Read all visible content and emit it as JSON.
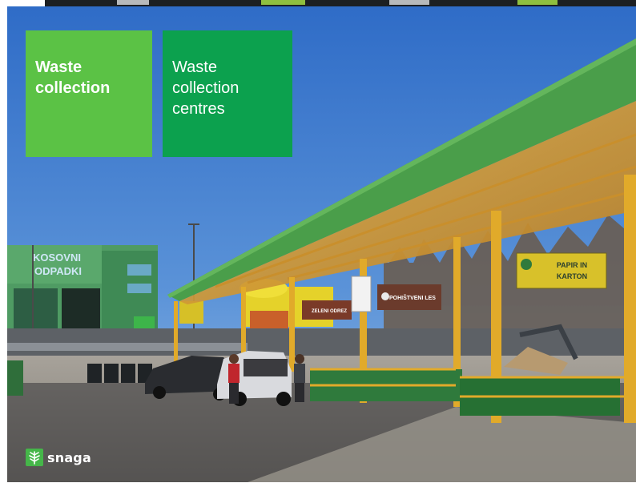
{
  "tiles": [
    {
      "line1": "Waste",
      "line2": "collection",
      "line3": ""
    },
    {
      "line1": "Waste",
      "line2": "collection",
      "line3": "centres"
    }
  ],
  "signs": {
    "building": {
      "line1": "KOSOVNI",
      "line2": "ODPADKI"
    },
    "papir": {
      "line1": "PAPIR IN",
      "line2": "KARTON"
    },
    "pohistveni": "POHIŠTVENI LES",
    "zeleni": "ZELENI ODREZ"
  },
  "brand": {
    "name": "snaga",
    "logo_icon": "leaf-icon",
    "color": "#45b649"
  },
  "colors": {
    "tile_light_green": "#5bc245",
    "tile_dark_green": "#0ca14e",
    "roof_green": "#4a9e4a",
    "sky_blue": "#3f7fd0",
    "sign_yellow": "#d8c12a"
  }
}
